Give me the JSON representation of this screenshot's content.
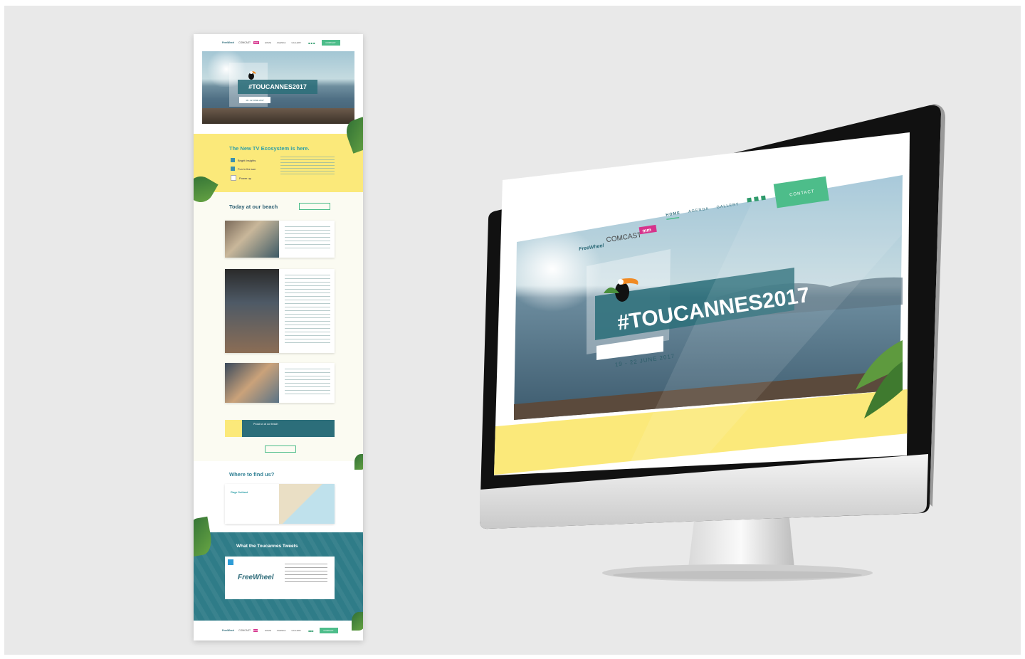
{
  "page_mockup": {
    "nav": {
      "logos": [
        "FreeWheel",
        "COMCAST",
        "mm"
      ],
      "items": [
        "HOME",
        "AGENDA",
        "GALLERY"
      ],
      "contact_label": "CONTACT"
    },
    "hero": {
      "hashtag": "#TOUCANNES2017",
      "date": "19 - 22 JUNE 2017"
    },
    "ecosystem": {
      "heading": "The New TV Ecosystem is here.",
      "list": [
        "Bright Insights",
        "Fun in the sun",
        "Power up"
      ]
    },
    "beach": {
      "heading": "Today at our beach",
      "promo_title": "Proud us at our beach"
    },
    "where": {
      "heading": "Where to find us?",
      "place": "Plage Goëland"
    },
    "tweets": {
      "heading": "What the Toucannes Tweets",
      "brand": "FreeWheel"
    }
  },
  "monitor": {
    "nav": {
      "logos": [
        "FreeWheel",
        "COMCAST",
        "mm"
      ],
      "items": [
        "HOME",
        "AGENDA",
        "GALLERY"
      ],
      "contact_label": "CONTACT"
    },
    "hero": {
      "hashtag": "#TOUCANNES2017",
      "date": "19 - 22 JUNE 2017"
    }
  },
  "colors": {
    "background": "#e9e9e9",
    "teal": "#2c6e7a",
    "mint": "#4dbd8a",
    "yellow": "#fbe97a",
    "magenta": "#d6338c"
  }
}
